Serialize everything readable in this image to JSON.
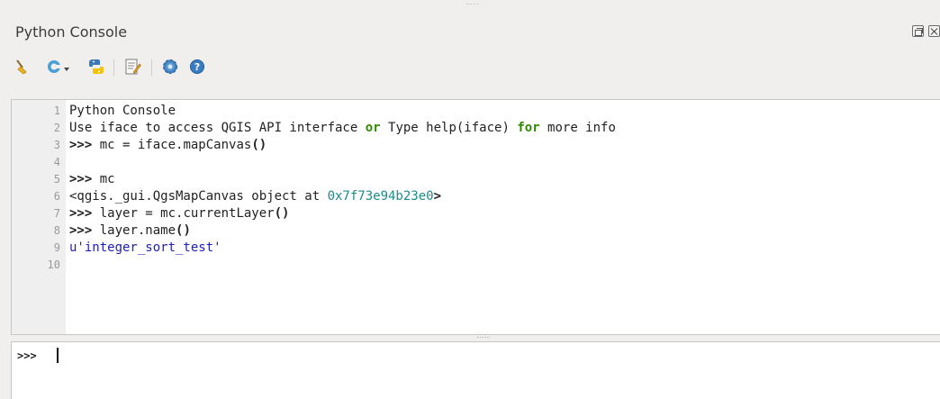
{
  "window": {
    "title": "Python Console"
  },
  "toolbar": {
    "buttons": [
      {
        "icon": "clear-console-icon"
      },
      {
        "icon": "import-class-icon"
      },
      {
        "icon": "run-command-icon"
      },
      {
        "icon": "show-editor-icon"
      },
      {
        "icon": "settings-icon"
      },
      {
        "icon": "help-icon"
      }
    ]
  },
  "editor": {
    "lines": [
      {
        "num": "1",
        "parts": [
          {
            "t": "Python Console",
            "c": ""
          }
        ]
      },
      {
        "num": "2",
        "parts": [
          {
            "t": "Use iface to access QGIS API interface ",
            "c": ""
          },
          {
            "t": "or",
            "c": "kw"
          },
          {
            "t": " Type help(iface) ",
            "c": ""
          },
          {
            "t": "for",
            "c": "kw"
          },
          {
            "t": " more info",
            "c": ""
          }
        ]
      },
      {
        "num": "3",
        "parts": [
          {
            "t": ">>>",
            "c": "prompt"
          },
          {
            "t": " mc = iface.mapCanvas",
            "c": ""
          },
          {
            "t": "()",
            "c": "prompt"
          }
        ]
      },
      {
        "num": "4",
        "parts": []
      },
      {
        "num": "5",
        "parts": [
          {
            "t": ">>>",
            "c": "prompt"
          },
          {
            "t": " mc",
            "c": ""
          }
        ]
      },
      {
        "num": "6",
        "parts": [
          {
            "t": "<qgis._gui.QgsMapCanvas object at ",
            "c": ""
          },
          {
            "t": "0x7f73e94b23e0",
            "c": "hex"
          },
          {
            "t": ">",
            "c": "prompt"
          }
        ]
      },
      {
        "num": "7",
        "parts": [
          {
            "t": ">>>",
            "c": "prompt"
          },
          {
            "t": " layer = mc.currentLayer",
            "c": ""
          },
          {
            "t": "()",
            "c": "prompt"
          }
        ]
      },
      {
        "num": "8",
        "parts": [
          {
            "t": ">>>",
            "c": "prompt"
          },
          {
            "t": " layer.name",
            "c": ""
          },
          {
            "t": "()",
            "c": "prompt"
          }
        ]
      },
      {
        "num": "9",
        "parts": [
          {
            "t": "u'integer_sort_test'",
            "c": "str"
          }
        ]
      },
      {
        "num": "10",
        "parts": []
      }
    ]
  },
  "input": {
    "prompt": ">>>",
    "value": ""
  },
  "colors": {
    "keyword": "#2e8b00",
    "hex_number": "#1d8b8b",
    "string": "#2020b8",
    "line_number": "#9a9a9a"
  }
}
